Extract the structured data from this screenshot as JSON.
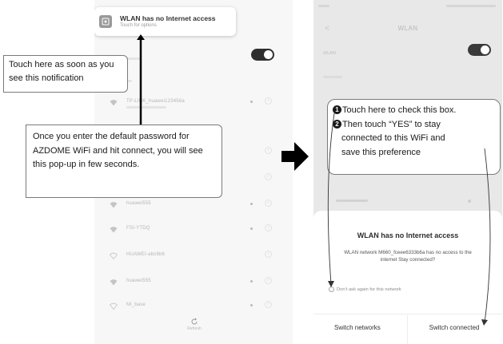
{
  "left_phone": {
    "notification": {
      "title": "WLAN has no Internet access",
      "subtitle": "Touch for options",
      "icon": "wifi-settings-icon"
    },
    "networks": [
      {
        "ssid": "TP-LINK_huawei123456a",
        "locked": true
      },
      {
        "ssid": "huawei555",
        "locked": true
      },
      {
        "ssid": "FSI-YTDQ",
        "locked": true
      },
      {
        "ssid": "HUAWEI-abc6b6",
        "locked": false
      },
      {
        "ssid": "huawei555",
        "locked": true
      },
      {
        "ssid": "Mi_base",
        "locked": true
      }
    ],
    "refresh_label": "Refresh"
  },
  "right_phone": {
    "title": "WLAN",
    "wlan_label": "WLAN",
    "dialog": {
      "title": "WLAN has no Internet access",
      "message": "WLAN network M660_fceee6333b6a has no access to the internet Stay connected?",
      "checkbox_label": "Don't ask again for this network",
      "button_left": "Switch networks",
      "button_right": "Switch connected"
    }
  },
  "callouts": {
    "notification_hint": "Touch here as soon as you see this notification",
    "password_hint": "Once you enter the default password for AZDOME WiFi and hit connect, you will see this pop-up in few seconds.",
    "step1_num": "1",
    "step1_text": "Touch here to check this box.",
    "step2_num": "2",
    "step2_text_a": "Then touch “YES” to stay",
    "step2_text_b": "connected to this WiFi and",
    "step2_text_c": "save this preference"
  },
  "colors": {
    "toggle_on": "#2f2f2f",
    "callout_border": "#7a7a7a",
    "arrow": "#000000"
  }
}
